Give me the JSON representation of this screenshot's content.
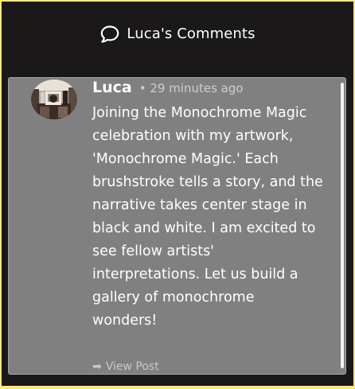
{
  "header": {
    "icon": "chat-bubble-icon",
    "title": "Luca's Comments"
  },
  "comment": {
    "author": "Luca",
    "time": "• 29 minutes ago",
    "text": "Joining the Monochrome Magic celebration with my artwork, 'Monochrome Magic.' Each brushstroke tells a story, and the narrative takes center stage in black and white. I am excited to see fellow artists' interpretations. Let us build a gallery of monochrome wonders!",
    "view_post_icon": "arrow-right-icon",
    "view_post_label": "View Post"
  },
  "colors": {
    "page_border": "#ffe97a",
    "background": "#1a1818",
    "card": "#808080"
  }
}
